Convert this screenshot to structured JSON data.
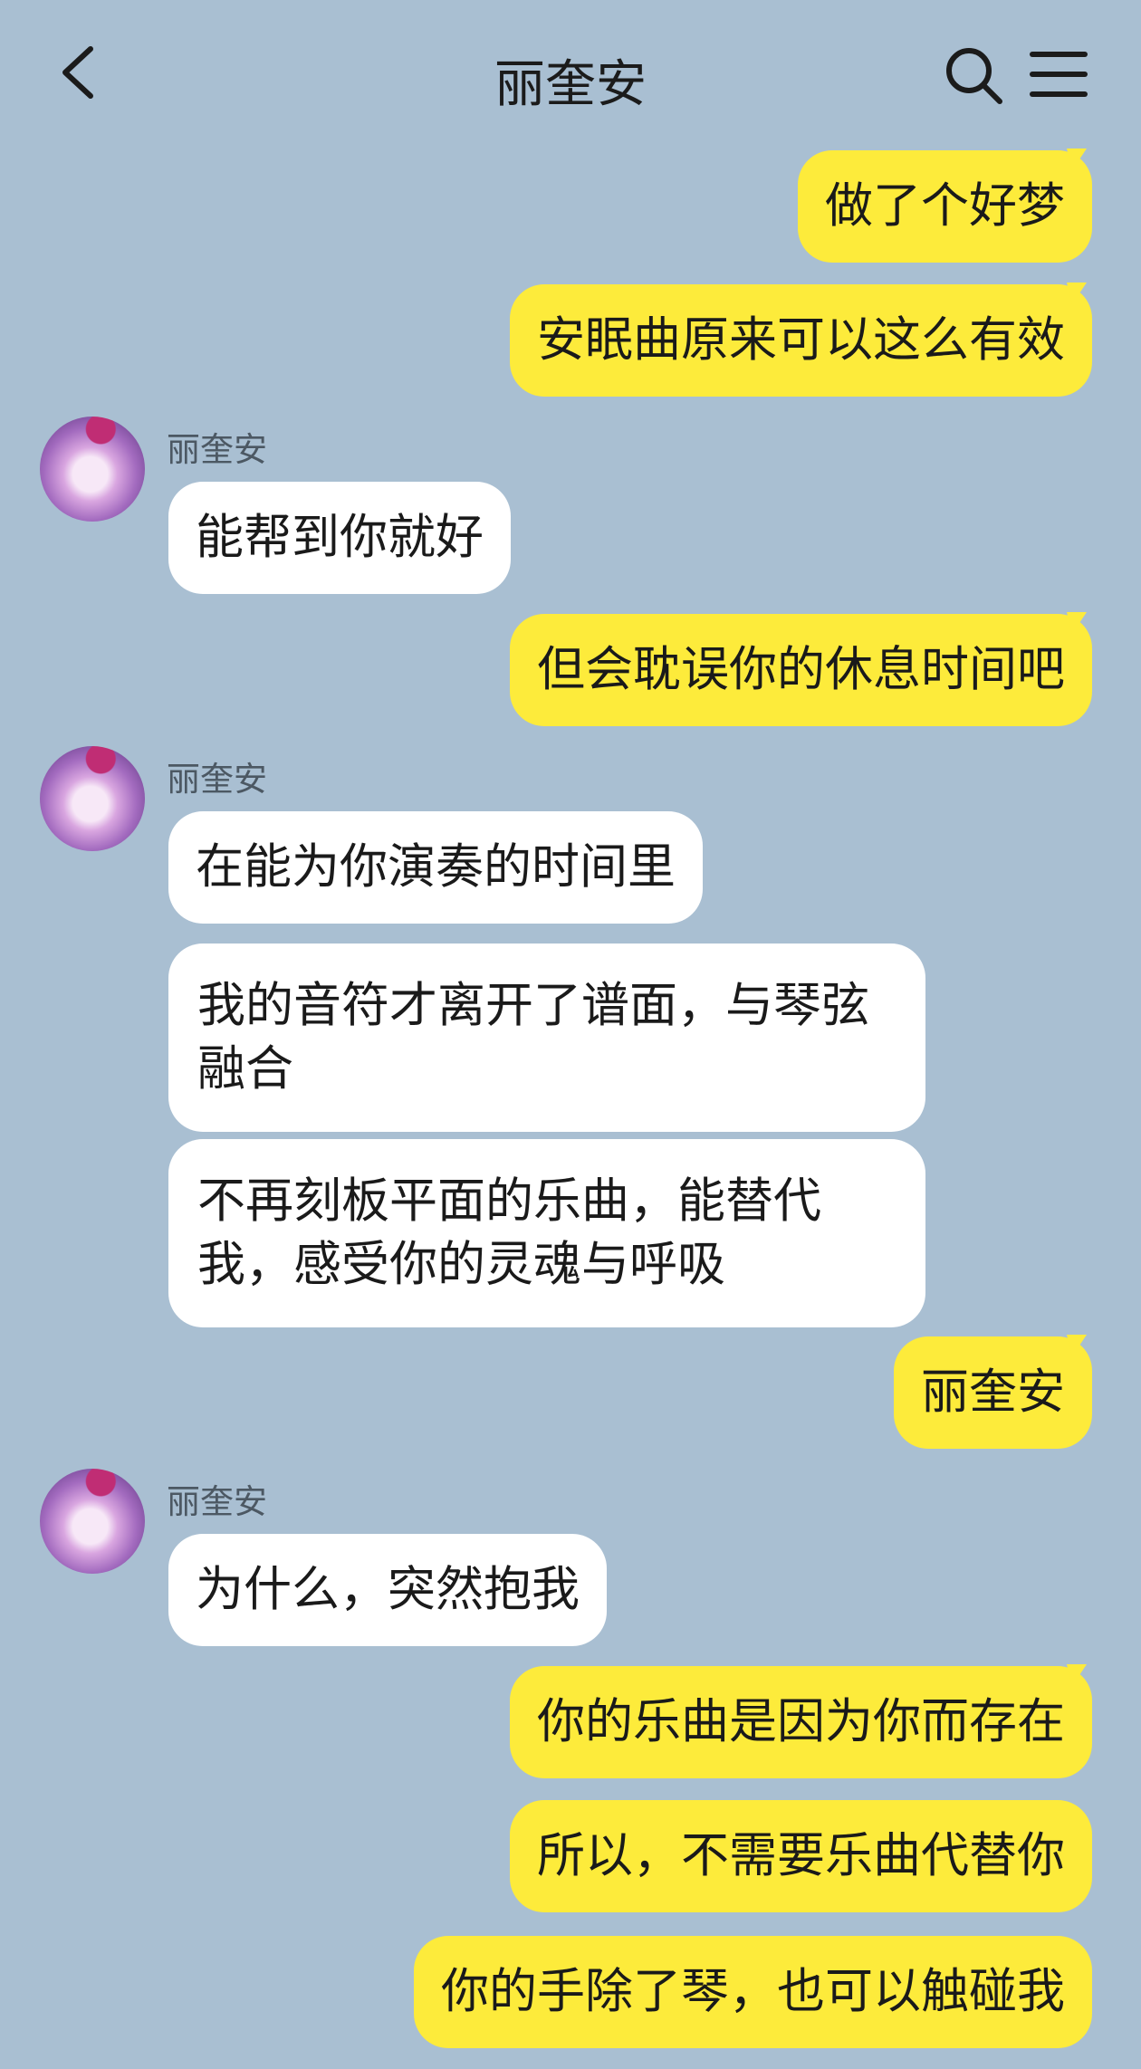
{
  "header": {
    "title": "丽奎安",
    "back_icon": "chevron-left-icon",
    "search_icon": "search-icon",
    "menu_icon": "menu-icon"
  },
  "colors": {
    "background": "#a9bfd2",
    "outgoing_bubble": "#fdeb3b",
    "incoming_bubble": "#ffffff"
  },
  "contact": {
    "name": "丽奎安"
  },
  "messages": [
    {
      "side": "out",
      "text": "做了个好梦"
    },
    {
      "side": "out",
      "text": "安眠曲原来可以这么有效"
    },
    {
      "side": "in",
      "sender": "丽奎安",
      "text": "能帮到你就好"
    },
    {
      "side": "out",
      "text": "但会耽误你的休息时间吧"
    },
    {
      "side": "in",
      "sender": "丽奎安",
      "text": "在能为你演奏的时间里"
    },
    {
      "side": "in",
      "text": "我的音符才离开了谱面，与琴弦融合"
    },
    {
      "side": "in",
      "text": "不再刻板平面的乐曲，能替代我，感受你的灵魂与呼吸"
    },
    {
      "side": "out",
      "text": "丽奎安"
    },
    {
      "side": "in",
      "sender": "丽奎安",
      "text": "为什么，突然抱我"
    },
    {
      "side": "out",
      "text": "你的乐曲是因为你而存在"
    },
    {
      "side": "out",
      "text": "所以，不需要乐曲代替你"
    },
    {
      "side": "out",
      "text": "你的手除了琴，也可以触碰我"
    }
  ]
}
